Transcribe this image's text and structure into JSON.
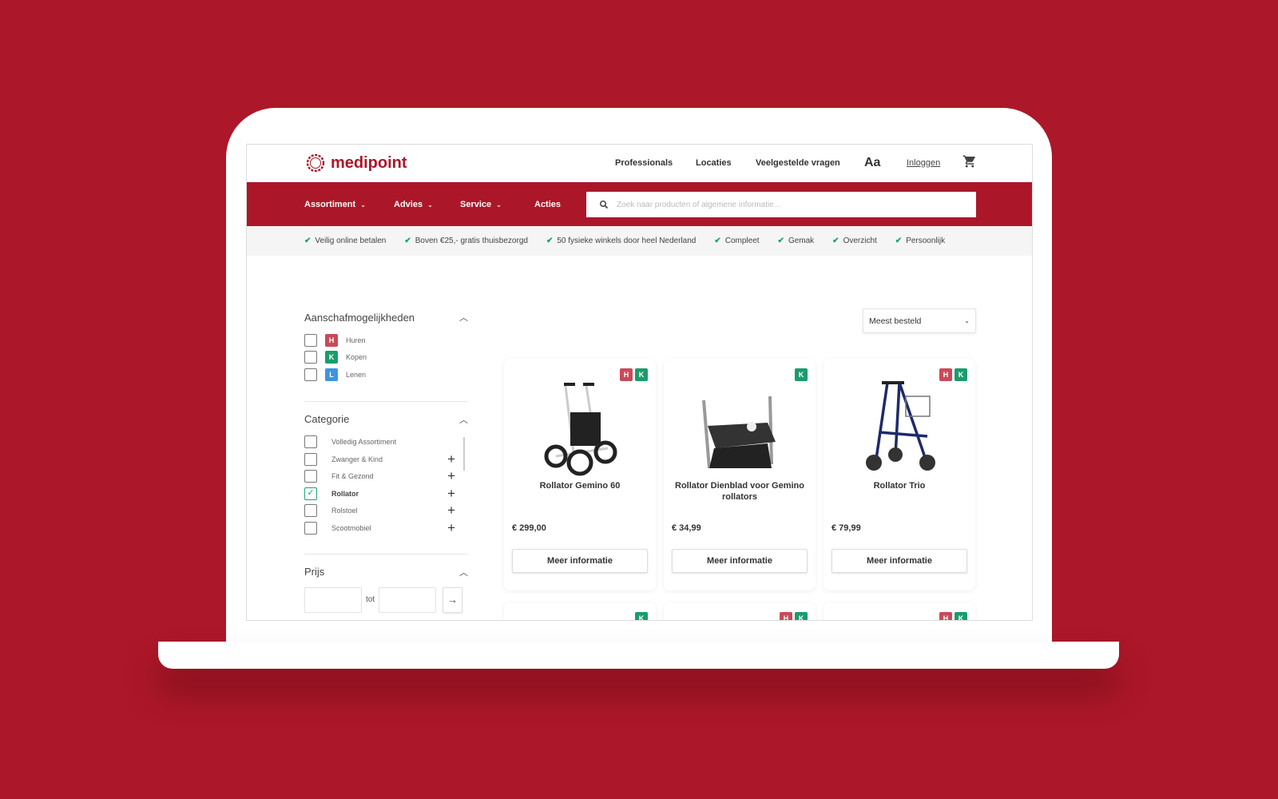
{
  "brand": {
    "name": "medipoint",
    "color": "#ab1729"
  },
  "header": {
    "links": [
      "Professionals",
      "Locaties",
      "Veelgestelde vragen"
    ],
    "font_size_toggle": "Aa",
    "login": "Inloggen",
    "cart_icon": "cart-icon"
  },
  "nav": {
    "items": [
      "Assortiment",
      "Advies",
      "Service",
      "Acties"
    ],
    "search_placeholder": "Zoek naar producten of algemene informatie..."
  },
  "usp": [
    "Veilig online betalen",
    "Boven €25,- gratis thuisbezorgd",
    "50 fysieke winkels door heel Nederland",
    "Compleet",
    "Gemak",
    "Overzicht",
    "Persoonlijk"
  ],
  "filters": {
    "purchase": {
      "title": "Aanschafmogelijkheden",
      "options": [
        {
          "badge": "H",
          "label": "Huren"
        },
        {
          "badge": "K",
          "label": "Kopen"
        },
        {
          "badge": "L",
          "label": "Lenen"
        }
      ]
    },
    "category": {
      "title": "Categorie",
      "options": [
        {
          "label": "Volledig Assortiment",
          "checked": false
        },
        {
          "label": "Zwanger & Kind",
          "checked": false
        },
        {
          "label": "Fit & Gezond",
          "checked": false
        },
        {
          "label": "Rollator",
          "checked": true
        },
        {
          "label": "Rolstoel",
          "checked": false
        },
        {
          "label": "Scootmobiel",
          "checked": false
        }
      ]
    },
    "price": {
      "title": "Prijs",
      "between": "tot",
      "min": "",
      "max": ""
    }
  },
  "sort": {
    "selected": "Meest besteld"
  },
  "badge_colors": {
    "H": "#c94a5a",
    "K": "#1a9c6c",
    "L": "#3d95e0"
  },
  "products": [
    {
      "title": "Rollator Gemino 60",
      "price": "€ 299,00",
      "badges": [
        "H",
        "K"
      ],
      "button": "Meer informatie"
    },
    {
      "title": "Rollator Dienblad voor Gemino rollators",
      "price": "€ 34,99",
      "badges": [
        "K"
      ],
      "button": "Meer informatie"
    },
    {
      "title": "Rollator Trio",
      "price": "€ 79,99",
      "badges": [
        "H",
        "K"
      ],
      "button": "Meer informatie"
    }
  ],
  "next_row_badges": [
    [
      "K"
    ],
    [
      "H",
      "K"
    ],
    [
      "H",
      "K"
    ]
  ]
}
